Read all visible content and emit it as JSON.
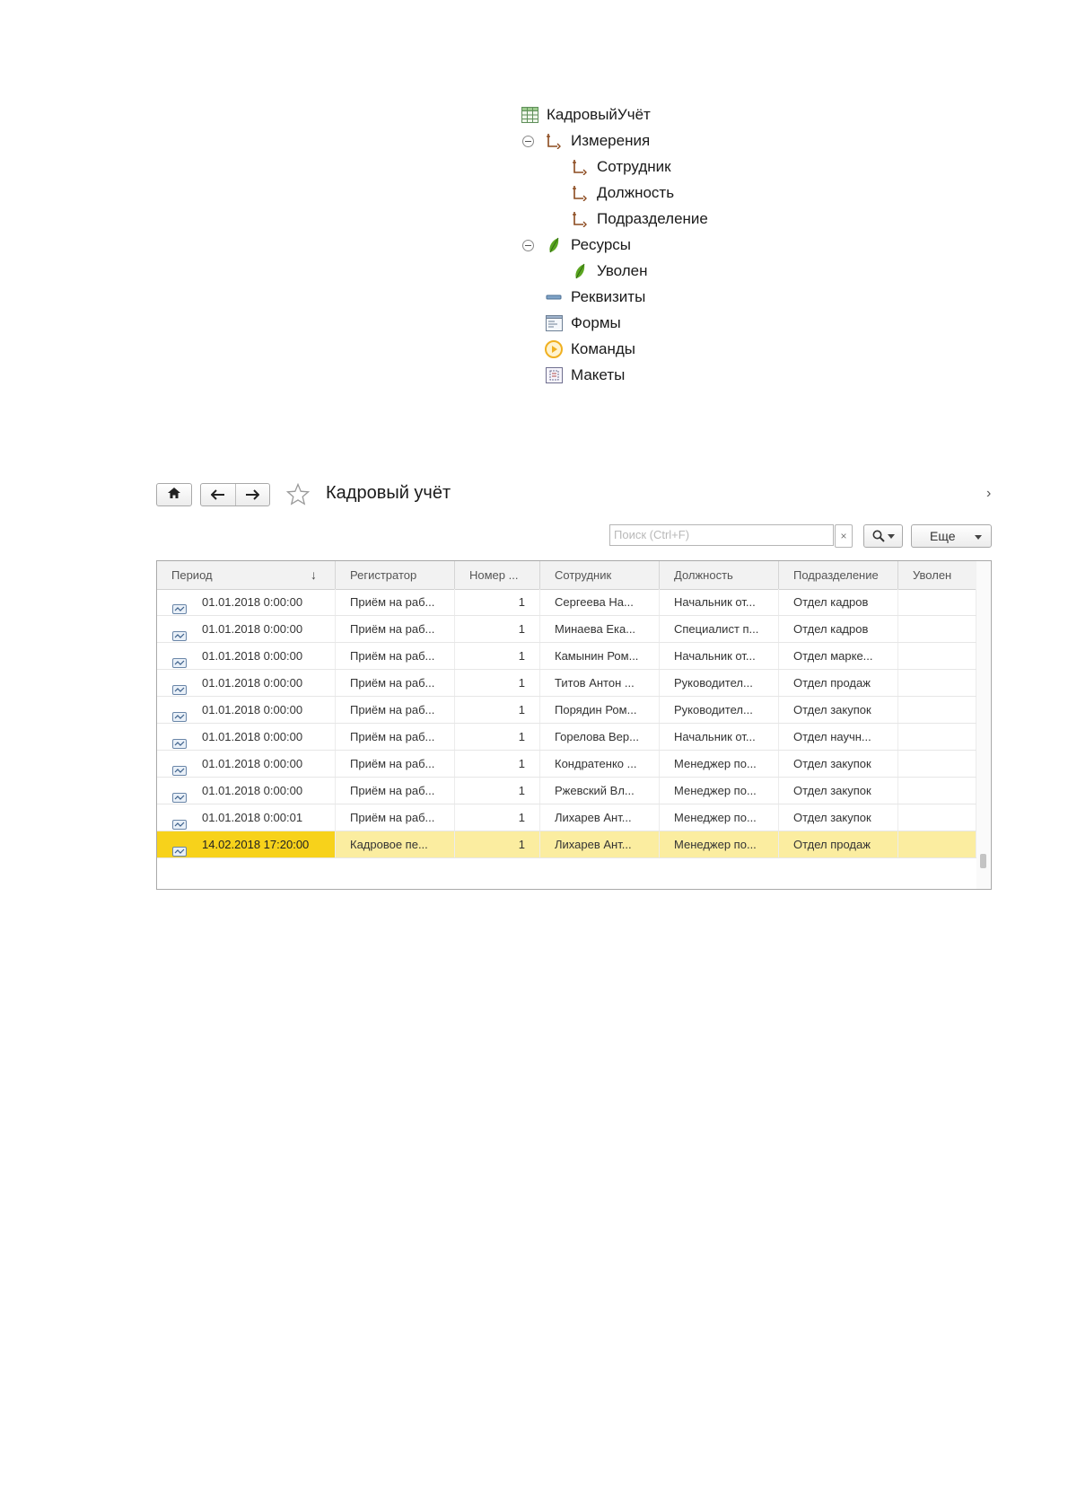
{
  "tree": {
    "root": "КадровыйУчёт",
    "dimensions_label": "Измерения",
    "dimensions": [
      "Сотрудник",
      "Должность",
      "Подразделение"
    ],
    "resources_label": "Ресурсы",
    "resources": [
      "Уволен"
    ],
    "attributes_label": "Реквизиты",
    "forms_label": "Формы",
    "commands_label": "Команды",
    "templates_label": "Макеты"
  },
  "form": {
    "title": "Кадровый учёт",
    "search_placeholder": "Поиск (Ctrl+F)",
    "clear_label": "×",
    "more_label": "Еще",
    "sort_arrow": "↓",
    "expand_glyph": "›"
  },
  "columns": [
    "Период",
    "Регистратор",
    "Номер ...",
    "Сотрудник",
    "Должность",
    "Подразделение",
    "Уволен"
  ],
  "rows": [
    {
      "period": "01.01.2018 0:00:00",
      "registrar": "Приём на раб...",
      "number": "1",
      "employee": "Сергеева На...",
      "position": "Начальник от...",
      "department": "Отдел кадров",
      "fired": ""
    },
    {
      "period": "01.01.2018 0:00:00",
      "registrar": "Приём на раб...",
      "number": "1",
      "employee": "Минаева Ека...",
      "position": "Специалист п...",
      "department": "Отдел кадров",
      "fired": ""
    },
    {
      "period": "01.01.2018 0:00:00",
      "registrar": "Приём на раб...",
      "number": "1",
      "employee": "Камынин Ром...",
      "position": "Начальник от...",
      "department": "Отдел марке...",
      "fired": ""
    },
    {
      "period": "01.01.2018 0:00:00",
      "registrar": "Приём на раб...",
      "number": "1",
      "employee": "Титов Антон ...",
      "position": "Руководител...",
      "department": "Отдел продаж",
      "fired": ""
    },
    {
      "period": "01.01.2018 0:00:00",
      "registrar": "Приём на раб...",
      "number": "1",
      "employee": "Порядин Ром...",
      "position": "Руководител...",
      "department": "Отдел закупок",
      "fired": ""
    },
    {
      "period": "01.01.2018 0:00:00",
      "registrar": "Приём на раб...",
      "number": "1",
      "employee": "Горелова Вер...",
      "position": "Начальник от...",
      "department": "Отдел научн...",
      "fired": ""
    },
    {
      "period": "01.01.2018 0:00:00",
      "registrar": "Приём на раб...",
      "number": "1",
      "employee": "Кондратенко ...",
      "position": "Менеджер по...",
      "department": "Отдел закупок",
      "fired": ""
    },
    {
      "period": "01.01.2018 0:00:00",
      "registrar": "Приём на раб...",
      "number": "1",
      "employee": "Ржевский Вл...",
      "position": "Менеджер по...",
      "department": "Отдел закупок",
      "fired": ""
    },
    {
      "period": "01.01.2018 0:00:01",
      "registrar": "Приём на раб...",
      "number": "1",
      "employee": "Лихарев Ант...",
      "position": "Менеджер по...",
      "department": "Отдел закупок",
      "fired": ""
    },
    {
      "period": "14.02.2018 17:20:00",
      "registrar": "Кадровое пе...",
      "number": "1",
      "employee": "Лихарев Ант...",
      "position": "Менеджер по...",
      "department": "Отдел продаж",
      "fired": "",
      "selected": true
    }
  ],
  "colors": {
    "selected_row": "#fbeda0",
    "selected_cell": "#f7d21b",
    "dimension_icon": "#8c4a1e",
    "resource_icon": "#5aa520",
    "command_icon": "#f0b020"
  }
}
